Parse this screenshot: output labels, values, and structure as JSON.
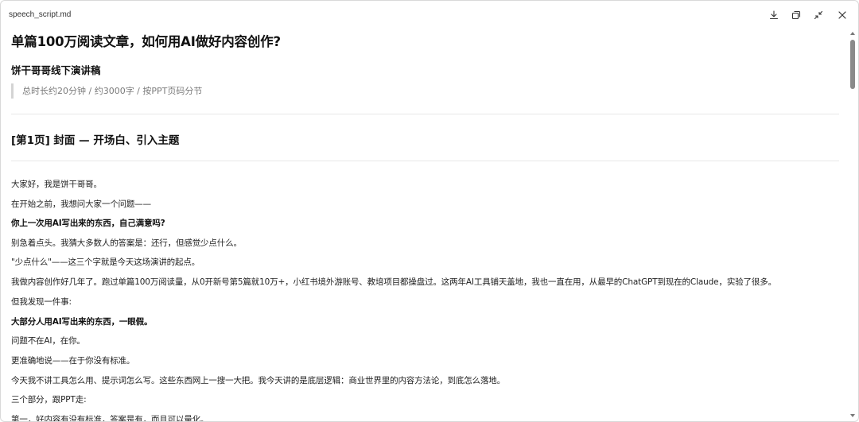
{
  "window": {
    "filename": "speech_script.md"
  },
  "toolbar": {
    "download_icon": "download-icon",
    "copy_icon": "copy-icon",
    "collapse_icon": "collapse-icon",
    "close_icon": "close-icon"
  },
  "doc": {
    "title": "单篇100万阅读文章，如何用AI做好内容创作?",
    "subtitle": "饼干哥哥线下演讲稿",
    "quote": "总时长约20分钟 / 约3000字 / 按PPT页码分节",
    "section1_heading": "[第1页] 封面 — 开场白、引入主题",
    "paragraphs": [
      {
        "text": "大家好，我是饼干哥哥。",
        "bold": false
      },
      {
        "text": "在开始之前，我想问大家一个问题——",
        "bold": false
      },
      {
        "text": "你上一次用AI写出来的东西，自己满意吗?",
        "bold": true
      },
      {
        "text": "别急着点头。我猜大多数人的答案是：还行，但感觉少点什么。",
        "bold": false
      },
      {
        "text": "\"少点什么\"——这三个字就是今天这场演讲的起点。",
        "bold": false
      },
      {
        "text": "我做内容创作好几年了。跑过单篇100万阅读量，从0开新号第5篇就10万+，小红书境外游账号、教培项目都操盘过。这两年AI工具铺天盖地，我也一直在用，从最早的ChatGPT到现在的Claude，实验了很多。",
        "bold": false
      },
      {
        "text": "但我发现一件事:",
        "bold": false
      },
      {
        "text": "大部分人用AI写出来的东西，一眼假。",
        "bold": true
      },
      {
        "text": "问题不在AI，在你。",
        "bold": false
      },
      {
        "text": "更准确地说——在于你没有标准。",
        "bold": false
      },
      {
        "text": "今天我不讲工具怎么用、提示词怎么写。这些东西网上一搜一大把。我今天讲的是底层逻辑：商业世界里的内容方法论，到底怎么落地。",
        "bold": false
      },
      {
        "text": "三个部分，跟PPT走:",
        "bold": false
      },
      {
        "text": "第一，好内容有没有标准，答案是有，而且可以量化。",
        "bold": false
      }
    ]
  }
}
